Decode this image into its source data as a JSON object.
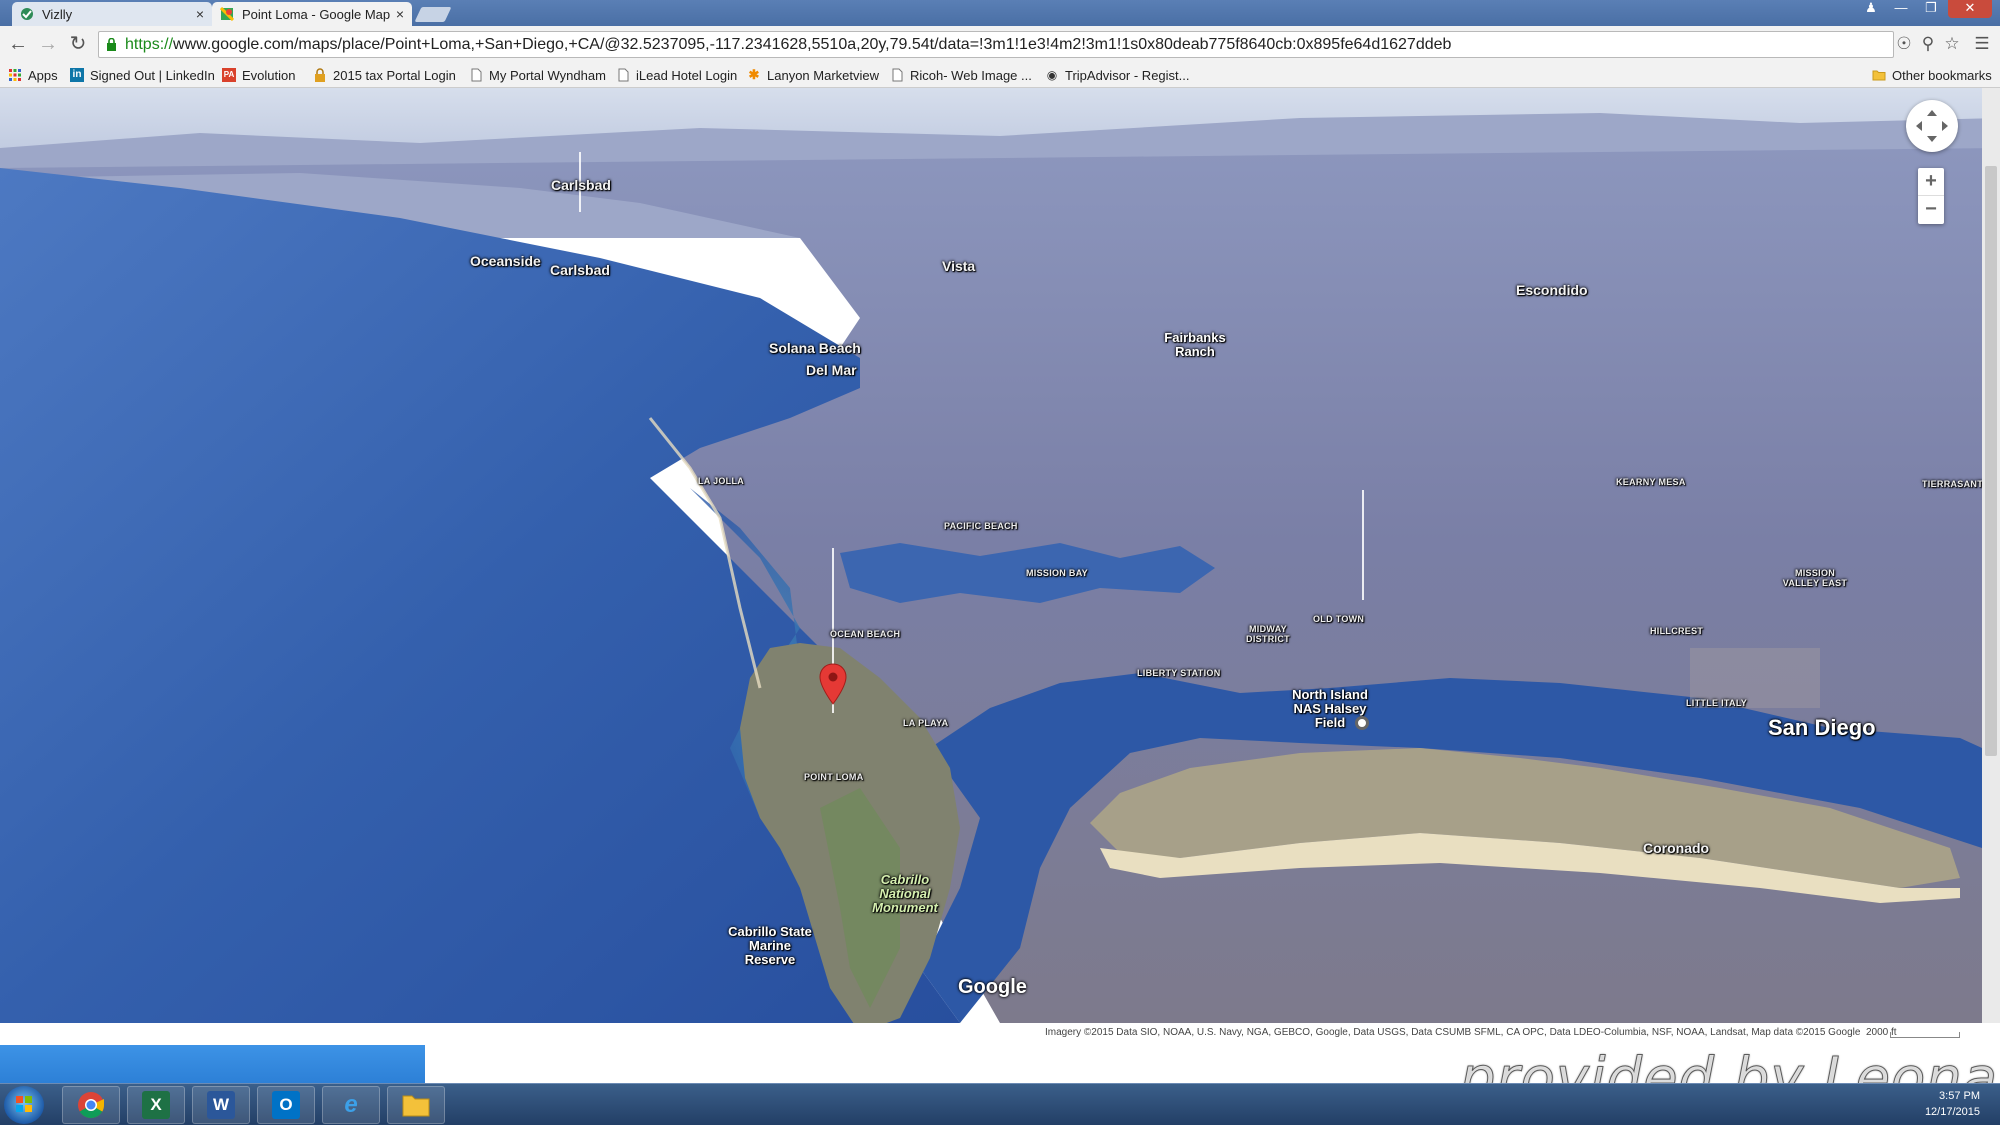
{
  "browser": {
    "tabs": [
      {
        "title": "Vizlly",
        "close": "×"
      },
      {
        "title": "Point Loma - Google Map",
        "close": "×"
      }
    ],
    "url_scheme": "https://",
    "url_rest": "www.google.com/maps/place/Point+Loma,+San+Diego,+CA/@32.5237095,-117.2341628,5510a,20y,79.54t/data=!3m1!1e3!4m2!3m1!1s0x80deab775f8640cb:0x895fe64d1627ddeb",
    "bookmarks": [
      {
        "label": "Apps"
      },
      {
        "label": "Signed Out | LinkedIn"
      },
      {
        "label": "Evolution"
      },
      {
        "label": "2015 tax  Portal Login"
      },
      {
        "label": "My Portal Wyndham"
      },
      {
        "label": "iLead Hotel Login"
      },
      {
        "label": "Lanyon Marketview"
      },
      {
        "label": "Ricoh- Web Image ..."
      },
      {
        "label": "TripAdvisor - Regist..."
      }
    ],
    "other_bookmarks": "Other bookmarks"
  },
  "map": {
    "labels": {
      "carlsbad_top": "Carlsbad",
      "carlsbad_bottom": "Carlsbad",
      "oceanside": "Oceanside",
      "vista": "Vista",
      "escondido": "Escondido",
      "fairbanks_ranch": "Fairbanks Ranch",
      "solana_beach": "Solana Beach",
      "del_mar": "Del Mar",
      "la_jolla": "LA JOLLA",
      "pacific_beach": "PACIFIC BEACH",
      "mission_bay": "MISSION BAY",
      "kearny_mesa": "KEARNY MESA",
      "tierrasanta": "TIERRASANTA",
      "mission_valley_east": "MISSION VALLEY EAST",
      "ocean_beach": "OCEAN BEACH",
      "midway_district": "MIDWAY DISTRICT",
      "old_town": "OLD TOWN",
      "hillcrest": "HILLCREST",
      "liberty_station": "LIBERTY STATION",
      "little_italy": "LITTLE ITALY",
      "north_island": "North Island NAS Halsey Field",
      "la_playa": "LA PLAYA",
      "point_loma": "POINT LOMA",
      "san_diego": "San Diego",
      "coronado": "Coronado",
      "cabrillo_monument": "Cabrillo National Monument",
      "cabrillo_reserve": "Cabrillo State Marine Reserve"
    },
    "logo": "Google",
    "zoom_in": "+",
    "zoom_out": "−",
    "attribution": "Imagery ©2015 Data SIO, NOAA, U.S. Navy, NGA, GEBCO, Google, Data USGS, Data CSUMB SFML, CA OPC, Data LDEO-Columbia, NSF, NOAA, Landsat, Map data ©2015 Google",
    "scale": "2000 ft"
  },
  "taskbar": {
    "apps": [
      {
        "name": "chrome",
        "glyph": ""
      },
      {
        "name": "excel",
        "glyph": "X"
      },
      {
        "name": "word",
        "glyph": "W"
      },
      {
        "name": "outlook",
        "glyph": "O"
      },
      {
        "name": "internet-explorer",
        "glyph": "e"
      },
      {
        "name": "file-explorer",
        "glyph": ""
      }
    ],
    "time": "3:57 PM",
    "date": "12/17/2015"
  },
  "watermark": "provided by Leonardo",
  "colors": {
    "ocean_deep": "#2e4f9c",
    "ocean_near": "#3d6ab6",
    "land": "#6e7aa6",
    "pin_red": "#e53935",
    "url_green": "#1a8a1a"
  }
}
